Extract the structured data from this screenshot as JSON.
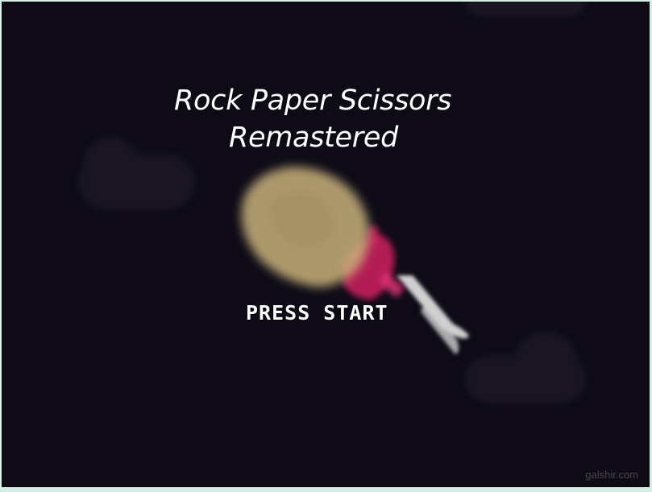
{
  "game": {
    "title_line_1": "Rock Paper Scissors",
    "title_line_2": "Remastered",
    "press_start": "PRESS START",
    "watermark": "galshir.com"
  },
  "colors": {
    "background": "#0e0b17",
    "frame_border": "#d7efe3",
    "cloud": "#1c1725",
    "rock": "#c8b27a",
    "paper_fold": "#d0225f",
    "scissors_blade": "#e6e6e6",
    "text": "#ffffff"
  },
  "icons": {
    "hero": "rock-paper-scissors-icon"
  }
}
